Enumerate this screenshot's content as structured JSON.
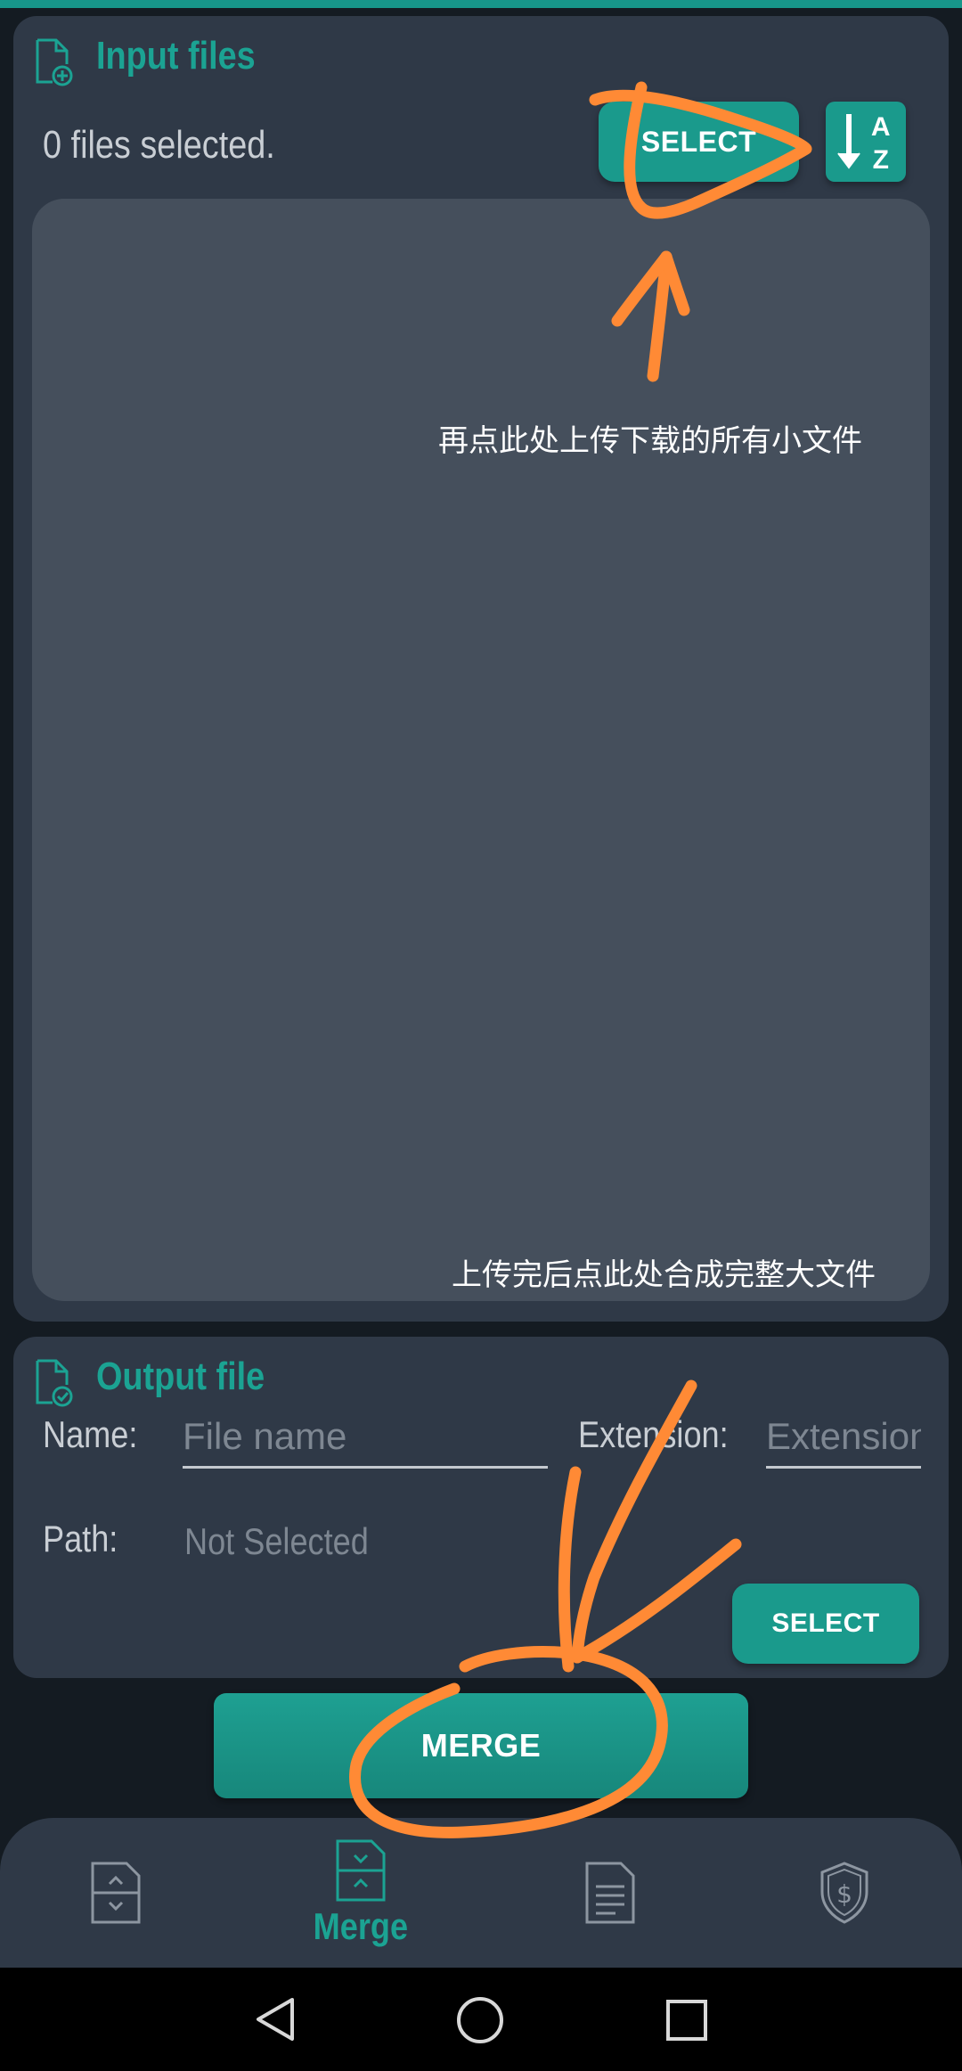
{
  "input_section": {
    "title": "Input files",
    "icon": "file-add-icon",
    "files_count": "0 files selected.",
    "select_label": "SELECT",
    "sort_icon_a": "A",
    "sort_icon_z": "Z"
  },
  "output_section": {
    "title": "Output file",
    "icon": "file-check-icon",
    "name_label": "Name:",
    "name_placeholder": "File name",
    "extension_label": "Extension:",
    "extension_placeholder": "Extension",
    "path_label": "Path:",
    "path_value": "Not Selected",
    "select_label": "SELECT"
  },
  "merge_label": "MERGE",
  "nav": {
    "items": [
      {
        "icon": "split-file-icon",
        "label": ""
      },
      {
        "icon": "merge-file-icon",
        "label": "Merge",
        "active": true
      },
      {
        "icon": "document-icon",
        "label": ""
      },
      {
        "icon": "shield-dollar-icon",
        "label": ""
      }
    ]
  },
  "annotations": {
    "first": "再点此处上传下载的所有小文件",
    "second": "上传完后点此处合成完整大文件",
    "stroke_color": "#ff8a35"
  },
  "colors": {
    "accent": "#1a9a8c",
    "card": "#2f3947",
    "list_bg": "#454f5c",
    "background": "#141b22"
  }
}
